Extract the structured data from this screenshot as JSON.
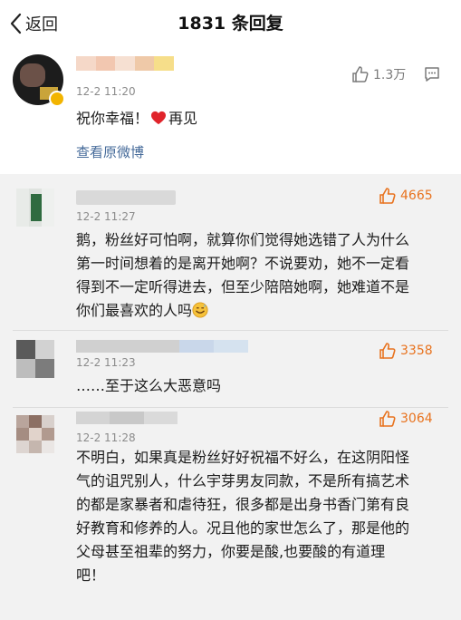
{
  "header": {
    "back_label": "返回",
    "title": "1831 条回复"
  },
  "main_comment": {
    "time": "12-2 11:20",
    "likes": "1.3万",
    "text_before": "祝你幸福！",
    "text_after": "再见",
    "view_original": "查看原微博",
    "colors": {
      "blur": [
        "#f3d9c2",
        "#f0c0a0",
        "#f7e18f"
      ]
    }
  },
  "replies": [
    {
      "time": "12-2 11:27",
      "likes": "4665",
      "lines": [
        "鹅，粉丝好可怕啊，就算你们觉得她选错了人为什么",
        "第一时间想着的是离开她啊？不说要劝，她不一定看",
        "得到不一定听得进去，但至少陪陪她啊，她难道不是",
        "你们最喜欢的人吗"
      ],
      "emoji": "sweat-smile-emoji"
    },
    {
      "time": "12-2 11:23",
      "likes": "3358",
      "lines": [
        "……至于这么大恶意吗"
      ]
    },
    {
      "time": "12-2 11:28",
      "likes": "3064",
      "lines": [
        "不明白，如果真是粉丝好好祝福不好么，在这阴阳怪",
        "气的诅咒别人，什么宇芽男友同款，不是所有搞艺术",
        "的都是家暴者和虐待狂，很多都是出身书香门第有良",
        "好教育和修养的人。况且他的家世怎么了，那是他的",
        "父母甚至祖辈的努力，你要是酸,也要酸的有道理",
        "吧！"
      ]
    }
  ],
  "colors": {
    "hot_like": "#e8731f",
    "link": "#466b9a",
    "reply_bg": "#f2f2f2"
  }
}
